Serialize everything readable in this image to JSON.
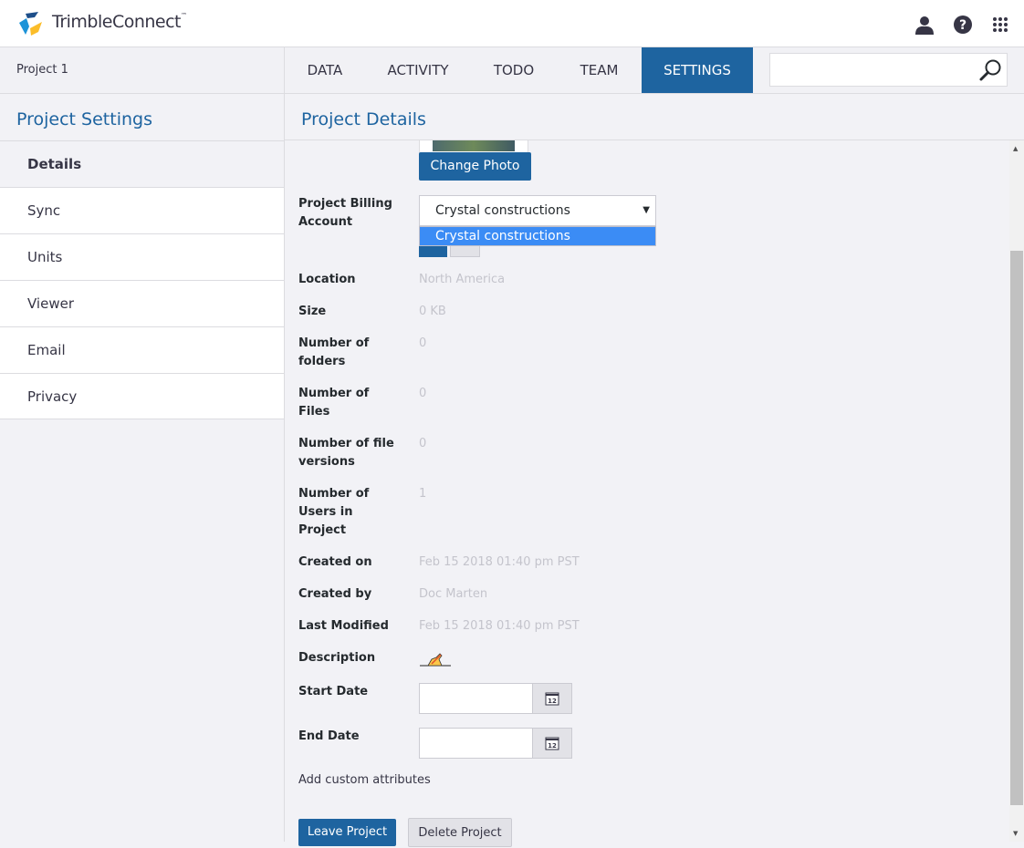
{
  "header": {
    "brand": "TrimbleConnect",
    "tm": "™",
    "icons": [
      "user-icon",
      "help-icon",
      "apps-grid-icon"
    ]
  },
  "nav": {
    "project": "Project 1",
    "tabs": [
      "DATA",
      "ACTIVITY",
      "TODO",
      "TEAM",
      "SETTINGS"
    ],
    "active": "SETTINGS"
  },
  "sidebar": {
    "title": "Project Settings",
    "items": [
      "Details",
      "Sync",
      "Units",
      "Viewer",
      "Email",
      "Privacy"
    ]
  },
  "main": {
    "title": "Project Details",
    "change_photo": "Change Photo",
    "billing": {
      "label": "Project Billing Account",
      "selected": "Crystal constructions",
      "option": "Crystal constructions"
    },
    "fields": [
      {
        "label": "Location",
        "value": "North America"
      },
      {
        "label": "Size",
        "value": "0 KB"
      },
      {
        "label": "Number of folders",
        "value": "0"
      },
      {
        "label": "Number of Files",
        "value": "0"
      },
      {
        "label": "Number of file versions",
        "value": "0"
      },
      {
        "label": "Number of Users in Project",
        "value": "1"
      },
      {
        "label": "Created on",
        "value": "Feb 15 2018 01:40 pm PST"
      },
      {
        "label": "Created by",
        "value": "Doc Marten"
      },
      {
        "label": "Last Modified",
        "value": "Feb 15 2018 01:40 pm PST"
      }
    ],
    "description_label": "Description",
    "start_date_label": "Start Date",
    "end_date_label": "End Date",
    "calendar_day": "12",
    "add_custom": "Add custom attributes",
    "leave": "Leave Project",
    "delete": "Delete Project"
  },
  "colors": {
    "accent": "#1e64a0",
    "highlight": "#3b8cf5"
  }
}
